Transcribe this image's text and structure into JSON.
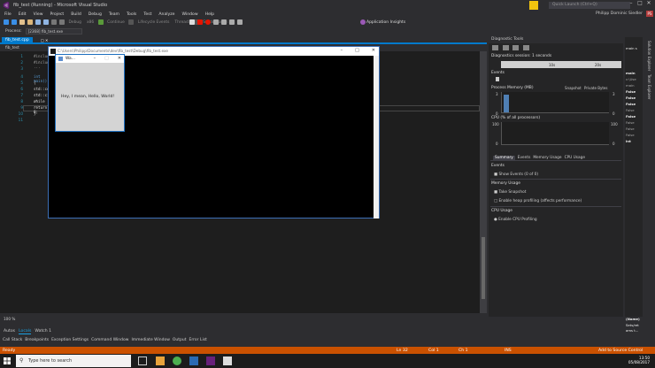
{
  "title_bar": {
    "title": "fib_test (Running) - Microsoft Visual Studio",
    "quick_launch_placeholder": "Quick Launch (Ctrl+Q)",
    "user": "Philipp Dominic Siedler",
    "user_initials": "PS"
  },
  "menu": [
    "File",
    "Edit",
    "View",
    "Project",
    "Build",
    "Debug",
    "Team",
    "Tools",
    "Test",
    "Analyze",
    "Window",
    "Help"
  ],
  "toolbar": {
    "debug_config": "Debug",
    "platform": "x86",
    "continue_label": "Continue",
    "lifecycle_events": "Lifecycle Events",
    "thread_label": "Thread:",
    "stack_frame": "Stack Frame:",
    "application_insights": "Application Insights"
  },
  "debug_location": {
    "process_label": "Process:",
    "process_value": "[2368] fib_test.exe"
  },
  "document": {
    "tab": "fib_test.cpp",
    "nav_item": "fib_test"
  },
  "code_lines": [
    {
      "n": "1",
      "text": "#include ..."
    },
    {
      "n": "2",
      "text": "#include ..."
    },
    {
      "n": "3",
      "text": ""
    },
    {
      "n": "4",
      "text": "int main()"
    },
    {
      "n": "5",
      "text": "{"
    },
    {
      "n": "6",
      "text": "    std::cout ..."
    },
    {
      "n": "7",
      "text": "    std::cin ..."
    },
    {
      "n": "8",
      "text": "    while ..."
    },
    {
      "n": "9",
      "text": "    return 0;"
    },
    {
      "n": "10",
      "text": "}"
    },
    {
      "n": "11",
      "text": ""
    }
  ],
  "console": {
    "path": "C:\\Users\\Philipp\\Documents\\dev\\fib_test\\Debug\\fib_test.exe"
  },
  "app_window": {
    "title": "Wa...",
    "message": "Hey, I mean, Hello, World!"
  },
  "diagnostic_tools": {
    "title": "Diagnostic Tools",
    "session": "Diagnostics session: 1 seconds",
    "tick_10s": "10s",
    "tick_20s": "20s",
    "events_section": "Events",
    "memory_section": "Process Memory (MB)",
    "snapshot_legend": "Snapshot",
    "private_bytes_legend": "Private Bytes",
    "mem_top": "3",
    "mem_bottom": "0",
    "mem_top_right": "3",
    "mem_bottom_right": "0",
    "cpu_section": "CPU (% of all processors)",
    "cpu_top": "100",
    "cpu_bottom": "0",
    "cpu_top_right": "100",
    "cpu_bottom_right": "0",
    "tabs": [
      "Summary",
      "Events",
      "Memory Usage",
      "CPU Usage"
    ],
    "events_heading": "Events",
    "show_events": "Show Events (0 of 0)",
    "memory_usage_heading": "Memory Usage",
    "take_snapshot": "Take Snapshot",
    "enable_heap": "Enable heap profiling (affects performance)",
    "cpu_usage_heading": "CPU Usage",
    "enable_cpu": "Enable CPU Profiling"
  },
  "autos_panel": {
    "header": "main s",
    "lines": [
      "main",
      "c:\\Use",
      "main",
      "False",
      "False",
      "False",
      "False",
      "False",
      "False",
      "False",
      "False",
      "int"
    ],
    "name_label": "(Name)",
    "bottom1": "Sets/ret",
    "bottom2": "ams t..."
  },
  "side_strip": [
    "Solution Explorer",
    "Team Explorer"
  ],
  "zoom": "100 %",
  "bottom_tabs": [
    "Autos",
    "Locals",
    "Watch 1"
  ],
  "bottom_tabs_active": 1,
  "call_tabs": [
    "Call Stack",
    "Breakpoints",
    "Exception Settings",
    "Command Window",
    "Immediate Window",
    "Output",
    "Error List"
  ],
  "status_bar": {
    "ready": "Ready",
    "ln": "Ln 32",
    "col": "Col 1",
    "ch": "Ch 1",
    "ins": "INS",
    "source_control": "Add to Source Control"
  },
  "taskbar": {
    "search_placeholder": "Type here to search",
    "time": "13:50",
    "date": "05/08/2017"
  },
  "colors": {
    "accent": "#007acc",
    "status": "#ca5100",
    "notification": "#f1c40f"
  }
}
